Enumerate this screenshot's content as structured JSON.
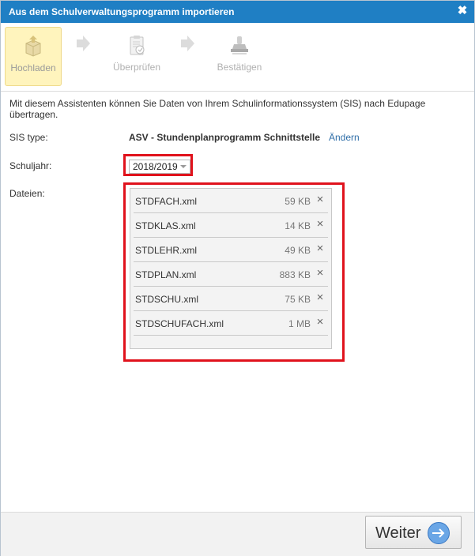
{
  "dialog": {
    "title": "Aus dem Schulverwaltungsprogramm importieren",
    "close_icon": "close-icon"
  },
  "wizard": {
    "steps": [
      {
        "label": "Hochladen",
        "icon": "upload-box-icon",
        "active": true
      },
      {
        "label": "Überprüfen",
        "icon": "clipboard-check-icon",
        "active": false
      },
      {
        "label": "Bestätigen",
        "icon": "stamp-icon",
        "active": false
      }
    ]
  },
  "intro": "Mit diesem Assistenten können Sie Daten von Ihrem Schulinformationssystem (SIS) nach Edupage übertragen.",
  "sis": {
    "label": "SIS type:",
    "value": "ASV - Stundenplanprogramm Schnittstelle",
    "change_link": "Ändern"
  },
  "school_year": {
    "label": "Schuljahr:",
    "selected": "2018/2019"
  },
  "files": {
    "label": "Dateien:",
    "items": [
      {
        "name": "STDFACH.xml",
        "size": "59 KB"
      },
      {
        "name": "STDKLAS.xml",
        "size": "14 KB"
      },
      {
        "name": "STDLEHR.xml",
        "size": "49 KB"
      },
      {
        "name": "STDPLAN.xml",
        "size": "883 KB"
      },
      {
        "name": "STDSCHU.xml",
        "size": "75 KB"
      },
      {
        "name": "STDSCHUFACH.xml",
        "size": "1 MB"
      }
    ],
    "remove_glyph": "×"
  },
  "footer": {
    "next_label": "Weiter"
  },
  "colors": {
    "titlebar": "#1f7fc4",
    "highlight": "#e0121c",
    "active_step": "#fff4bd",
    "link": "#2f6ea8"
  }
}
